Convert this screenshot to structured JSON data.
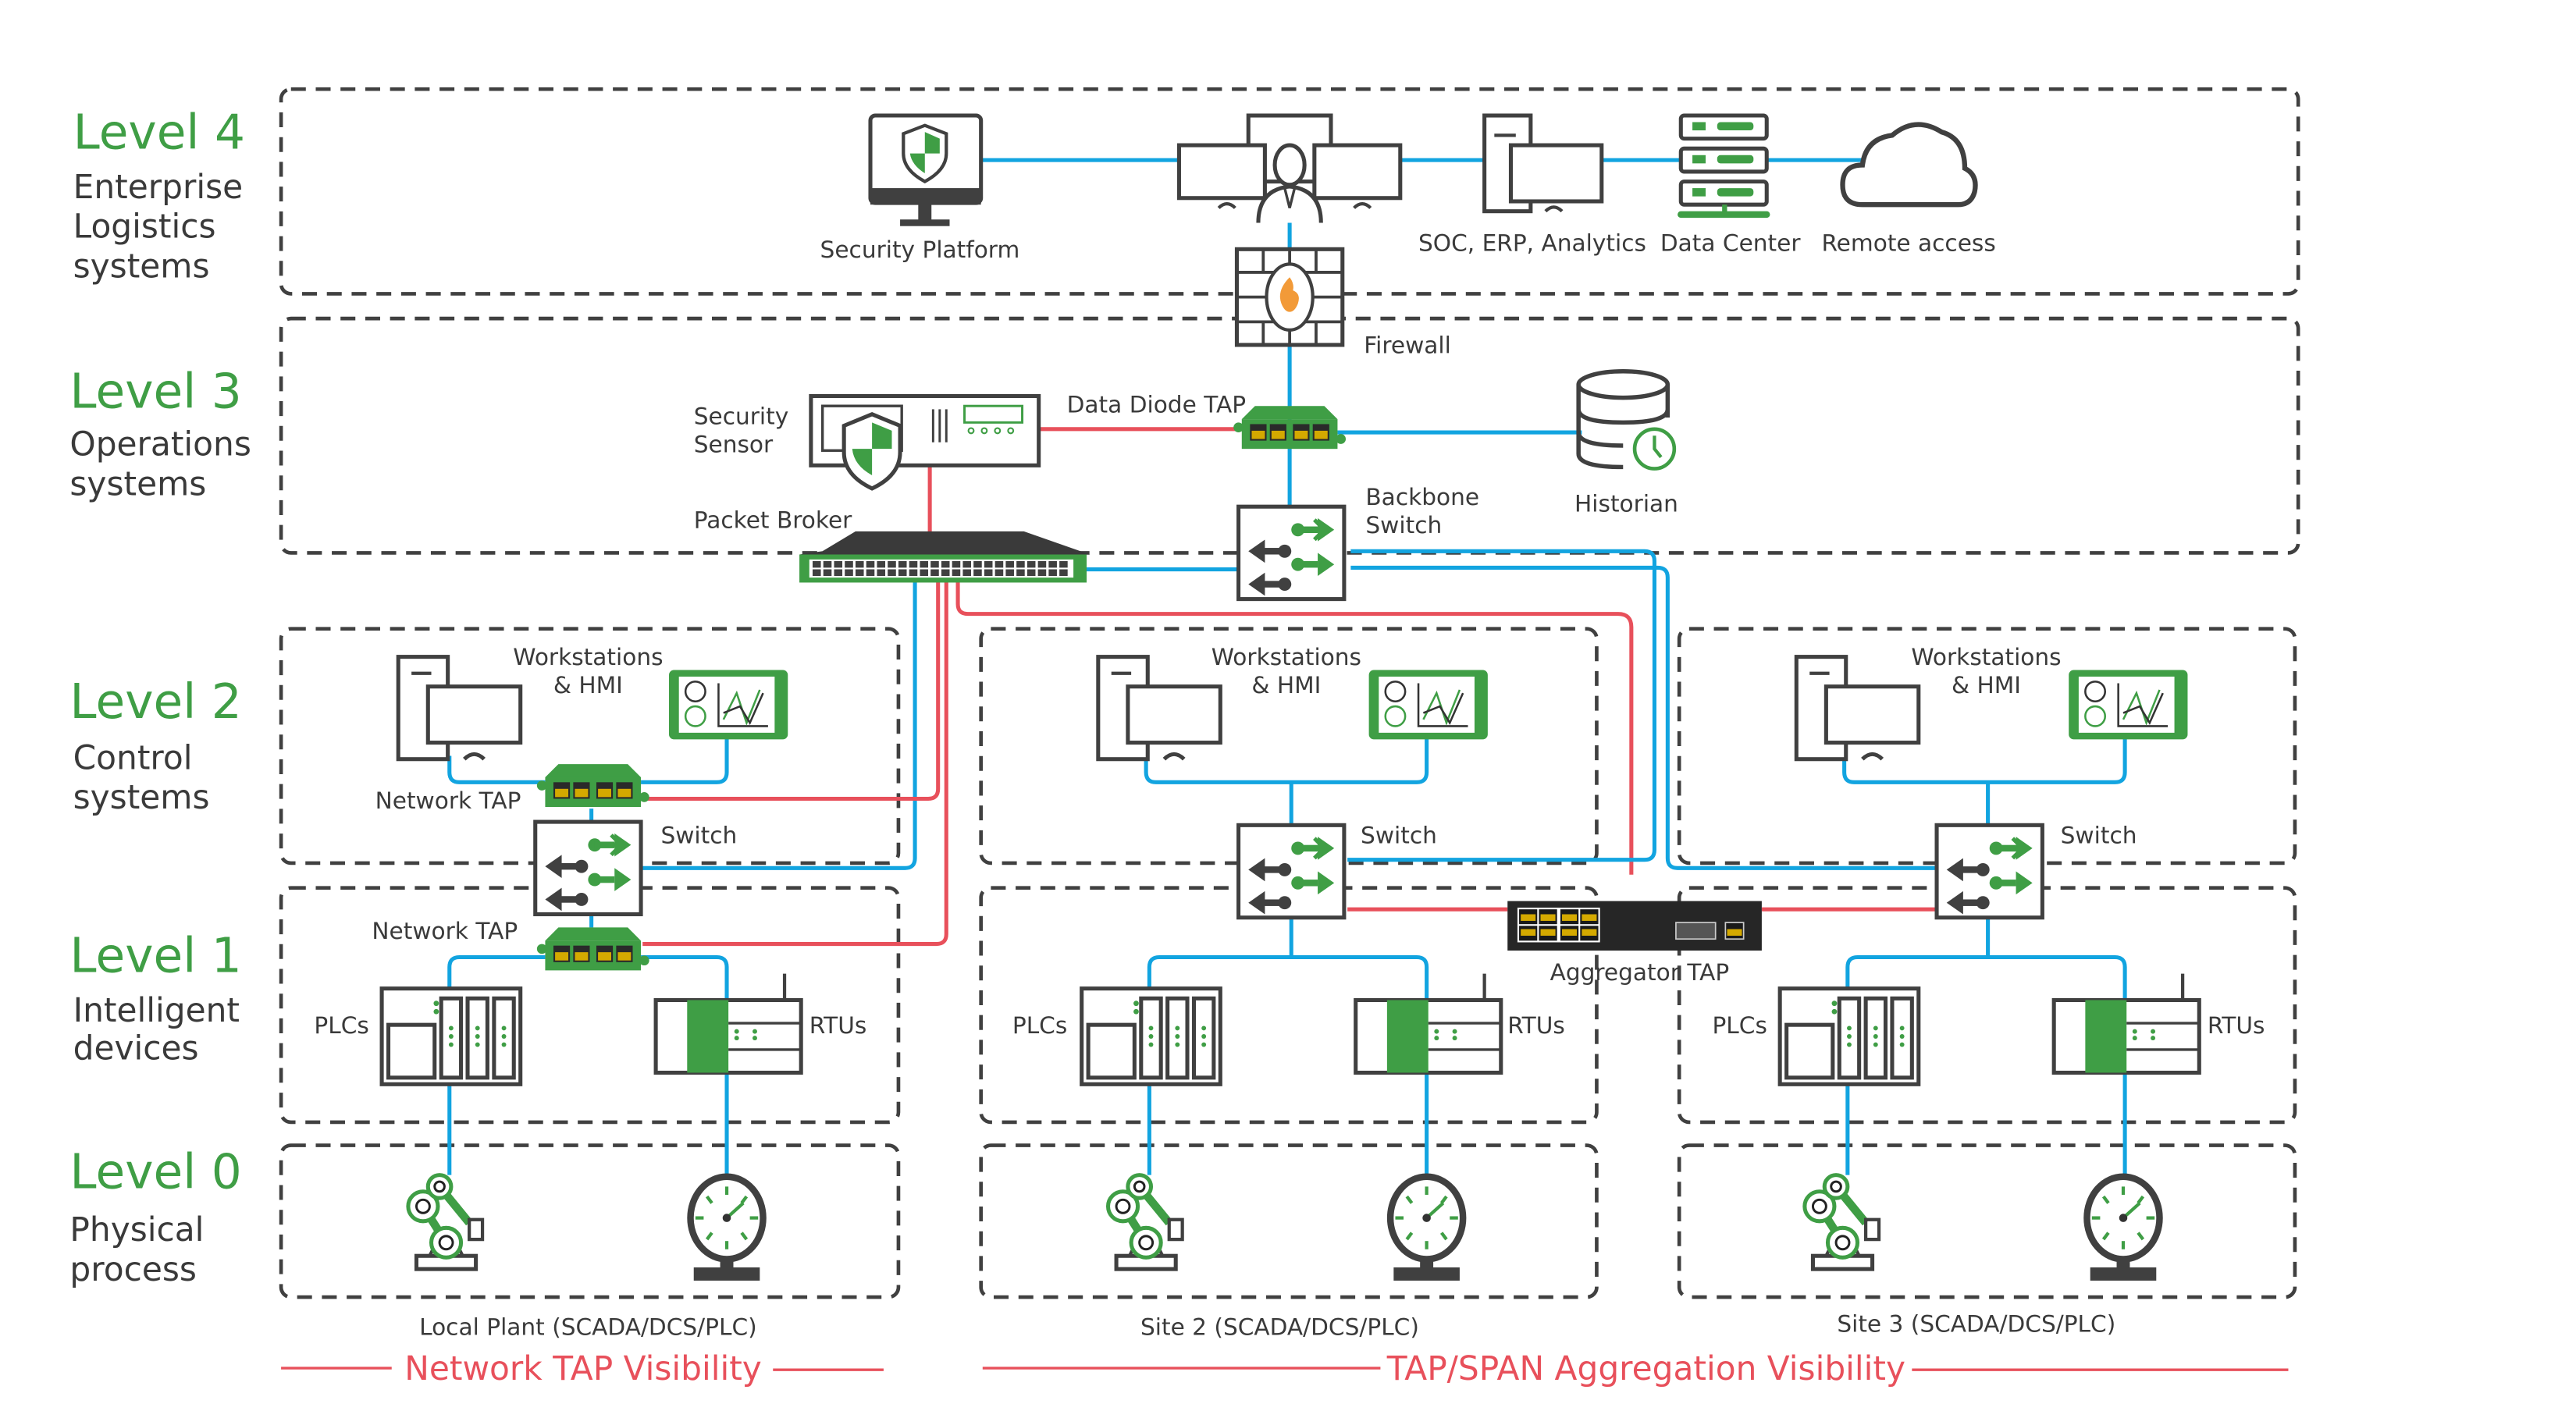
{
  "colors": {
    "accent_green": "#3f9e45",
    "link_blue": "#12a4e0",
    "monitor_red": "#e8505b",
    "outline": "#404040"
  },
  "levels": [
    {
      "title": "Level 4",
      "desc": [
        "Enterprise",
        "Logistics",
        "systems"
      ]
    },
    {
      "title": "Level 3",
      "desc": [
        "Operations",
        "systems"
      ]
    },
    {
      "title": "Level 2",
      "desc": [
        "Control",
        "systems"
      ]
    },
    {
      "title": "Level 1",
      "desc": [
        "Intelligent",
        "devices"
      ]
    },
    {
      "title": "Level 0",
      "desc": [
        "Physical",
        "process"
      ]
    }
  ],
  "level4": {
    "security_platform": "Security Platform",
    "soc": "SOC, ERP, Analytics",
    "data_center": "Data Center",
    "remote_access": "Remote access",
    "firewall": "Firewall"
  },
  "level3": {
    "security_sensor": [
      "Security",
      "Sensor"
    ],
    "data_diode_tap": "Data Diode TAP",
    "historian": "Historian",
    "packet_broker": "Packet Broker",
    "backbone_switch": [
      "Backbone",
      "Switch"
    ]
  },
  "sites": [
    {
      "name": "Local Plant (SCADA/DCS/PLC)",
      "workstations": [
        "Workstations",
        "& HMI"
      ],
      "network_tap_l2": "Network TAP",
      "switch": "Switch",
      "network_tap_l1": "Network TAP",
      "plcs": "PLCs",
      "rtus": "RTUs"
    },
    {
      "name": "Site 2 (SCADA/DCS/PLC)",
      "workstations": [
        "Workstations",
        "& HMI"
      ],
      "switch": "Switch",
      "plcs": "PLCs",
      "rtus": "RTUs"
    },
    {
      "name": "Site 3 (SCADA/DCS/PLC)",
      "workstations": [
        "Workstations",
        "& HMI"
      ],
      "switch": "Switch",
      "plcs": "PLCs",
      "rtus": "RTUs"
    }
  ],
  "aggregator_tap": "Aggregator TAP",
  "visibility": {
    "network_tap": "Network TAP Visibility",
    "aggregation": "TAP/SPAN Aggregation Visibility"
  }
}
